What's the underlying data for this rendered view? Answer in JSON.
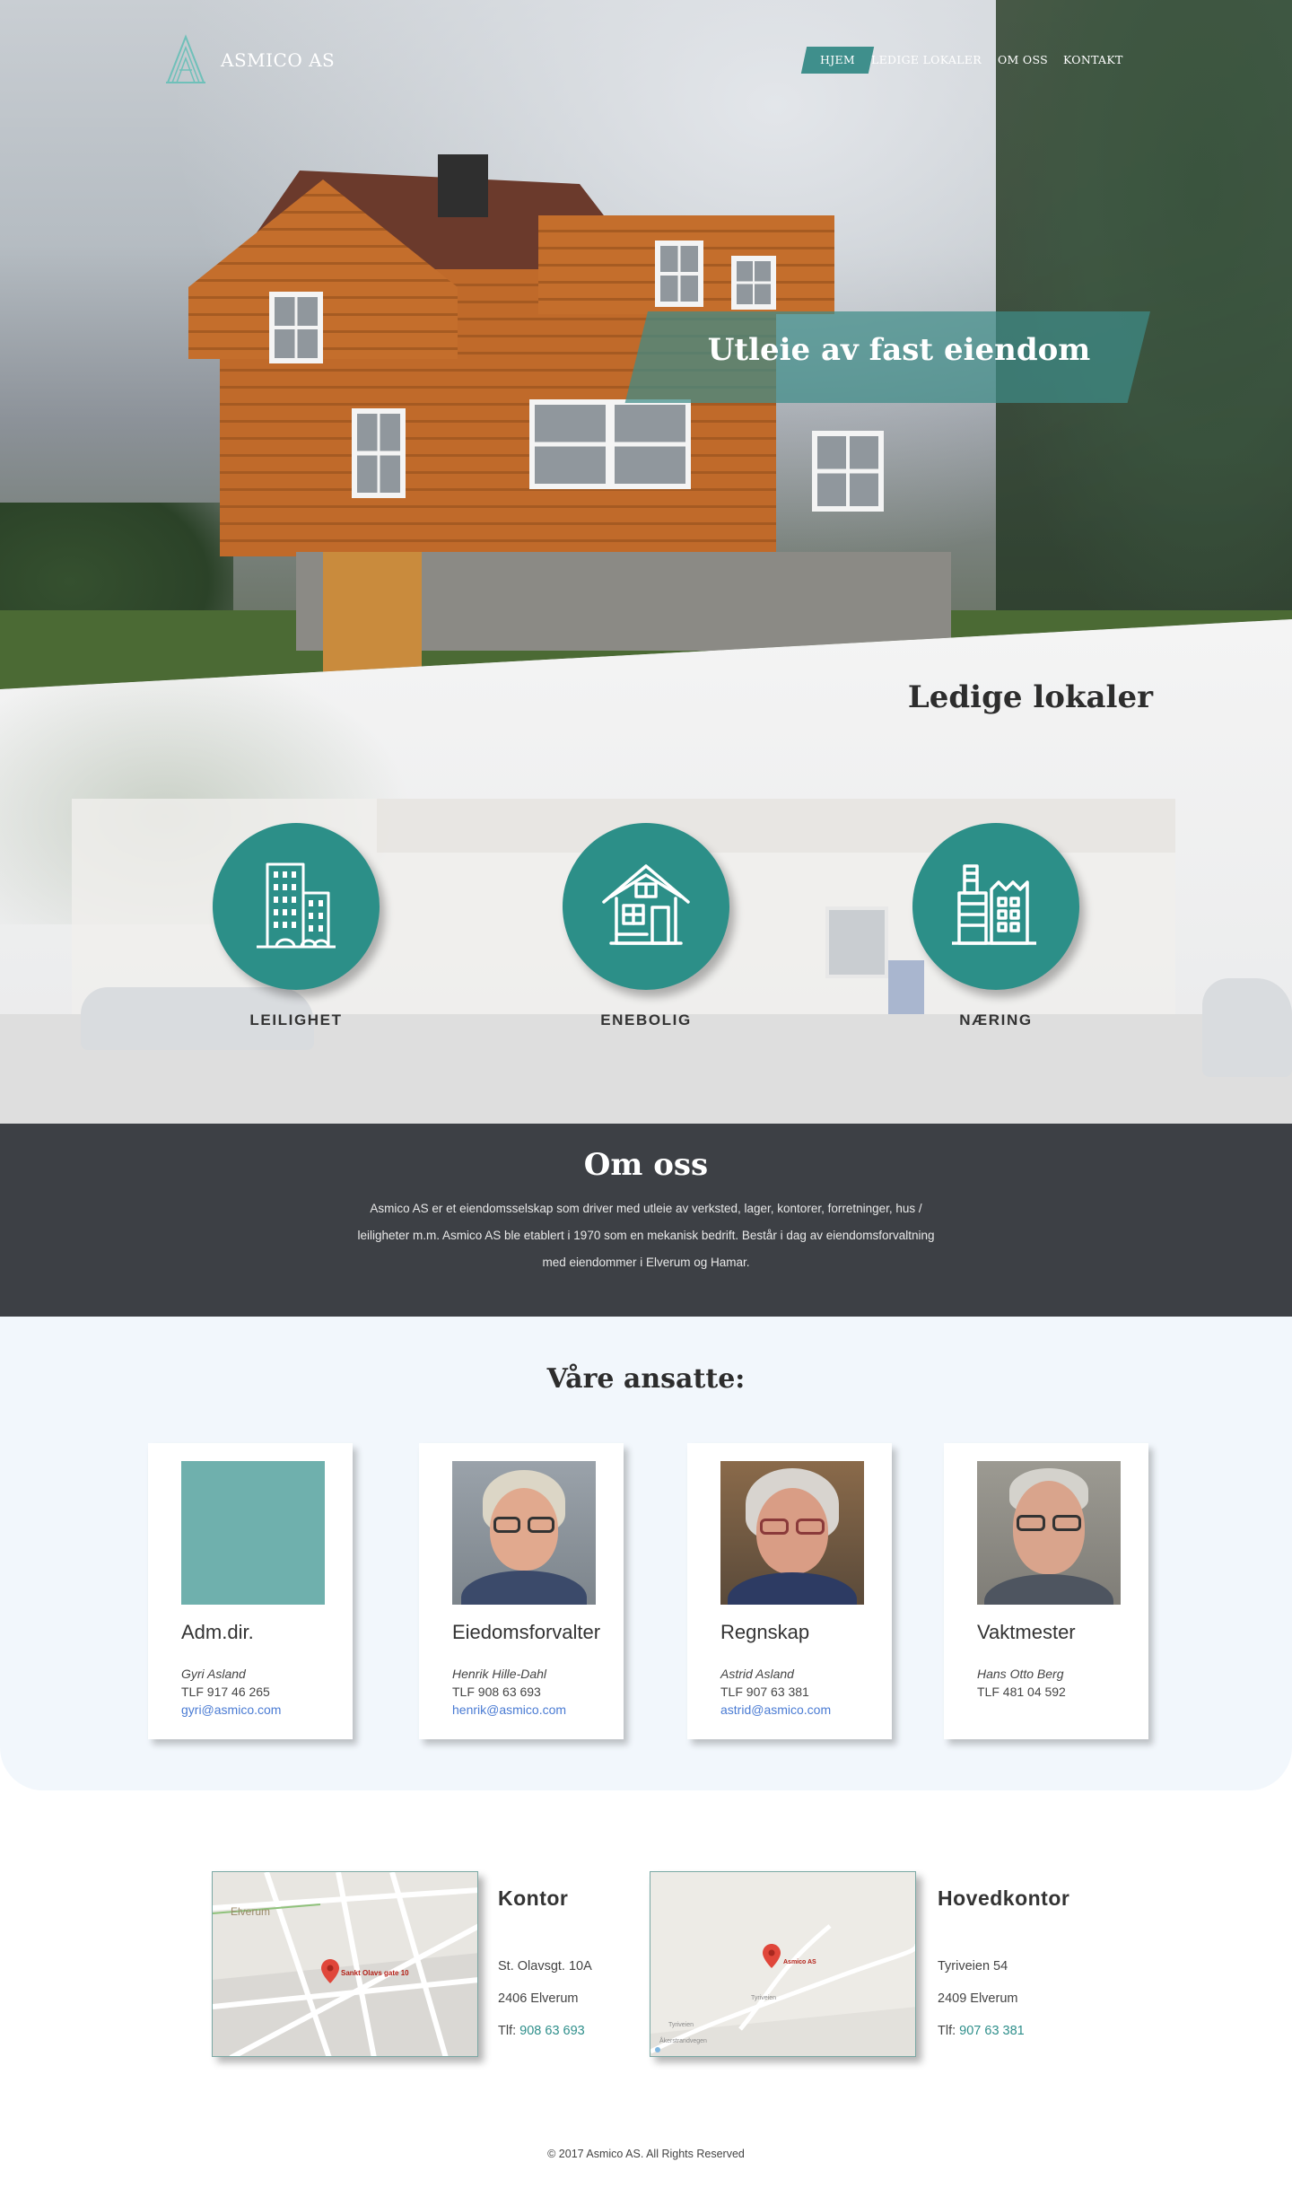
{
  "brand": {
    "name": "ASMICO AS"
  },
  "nav": {
    "items": [
      {
        "label": "HJEM",
        "active": true
      },
      {
        "label": "LEDIGE LOKALER",
        "active": false
      },
      {
        "label": "OM OSS",
        "active": false
      },
      {
        "label": "KONTAKT",
        "active": false
      }
    ]
  },
  "hero": {
    "title": "Utleie av fast eiendom"
  },
  "ledige": {
    "title": "Ledige lokaler",
    "categories": [
      {
        "label": "LEILIGHET",
        "icon": "apartment-building-icon"
      },
      {
        "label": "ENEBOLIG",
        "icon": "house-icon"
      },
      {
        "label": "NÆRING",
        "icon": "factory-icon"
      }
    ]
  },
  "om": {
    "title": "Om oss",
    "text": "Asmico AS er et eiendomsselskap som driver med utleie av verksted, lager, kontorer, forretninger, hus / leiligheter m.m. Asmico AS ble etablert i 1970 som en mekanisk bedrift. Består i dag av eiendomsforvaltning med eiendommer i Elverum og Hamar."
  },
  "ansatte": {
    "title": "Våre ansatte:",
    "cards": [
      {
        "role": "Adm.dir.",
        "name": "Gyri Asland",
        "tlf": "TLF 917 46 265",
        "email": "gyri@asmico.com"
      },
      {
        "role": "Eiedomsforvalter",
        "name": "Henrik Hille-Dahl",
        "tlf": "TLF 908 63 693",
        "email": "henrik@asmico.com"
      },
      {
        "role": "Regnskap",
        "name": "Astrid Asland",
        "tlf": "TLF 907 63 381",
        "email": "astrid@asmico.com"
      },
      {
        "role": "Vaktmester",
        "name": "Hans Otto Berg",
        "tlf": "TLF 481 04 592",
        "email": ""
      }
    ]
  },
  "kontakt": {
    "offices": [
      {
        "title": "Kontor",
        "address": "St. Olavsgt. 10A",
        "postal": "2406 Elverum",
        "phone_label": "Tlf:",
        "phone": "908 63 693",
        "map_city": "Elverum",
        "map_marker": "Sankt Olavs gate 10"
      },
      {
        "title": "Hovedkontor",
        "address": "Tyriveien 54",
        "postal": "2409 Elverum",
        "phone_label": "Tlf:",
        "phone": "907 63 381",
        "map_marker": "Asmico AS",
        "map_roads": [
          "Tyriveien",
          "Tyriveien",
          "Åkerstrandvegen"
        ]
      }
    ]
  },
  "footer": {
    "text": "© 2017 Asmico AS. All Rights Reserved"
  },
  "colors": {
    "accent": "#2c8f88",
    "dark": "#3d4045",
    "light_bg": "#f2f7fc",
    "link": "#4a7bd3"
  }
}
